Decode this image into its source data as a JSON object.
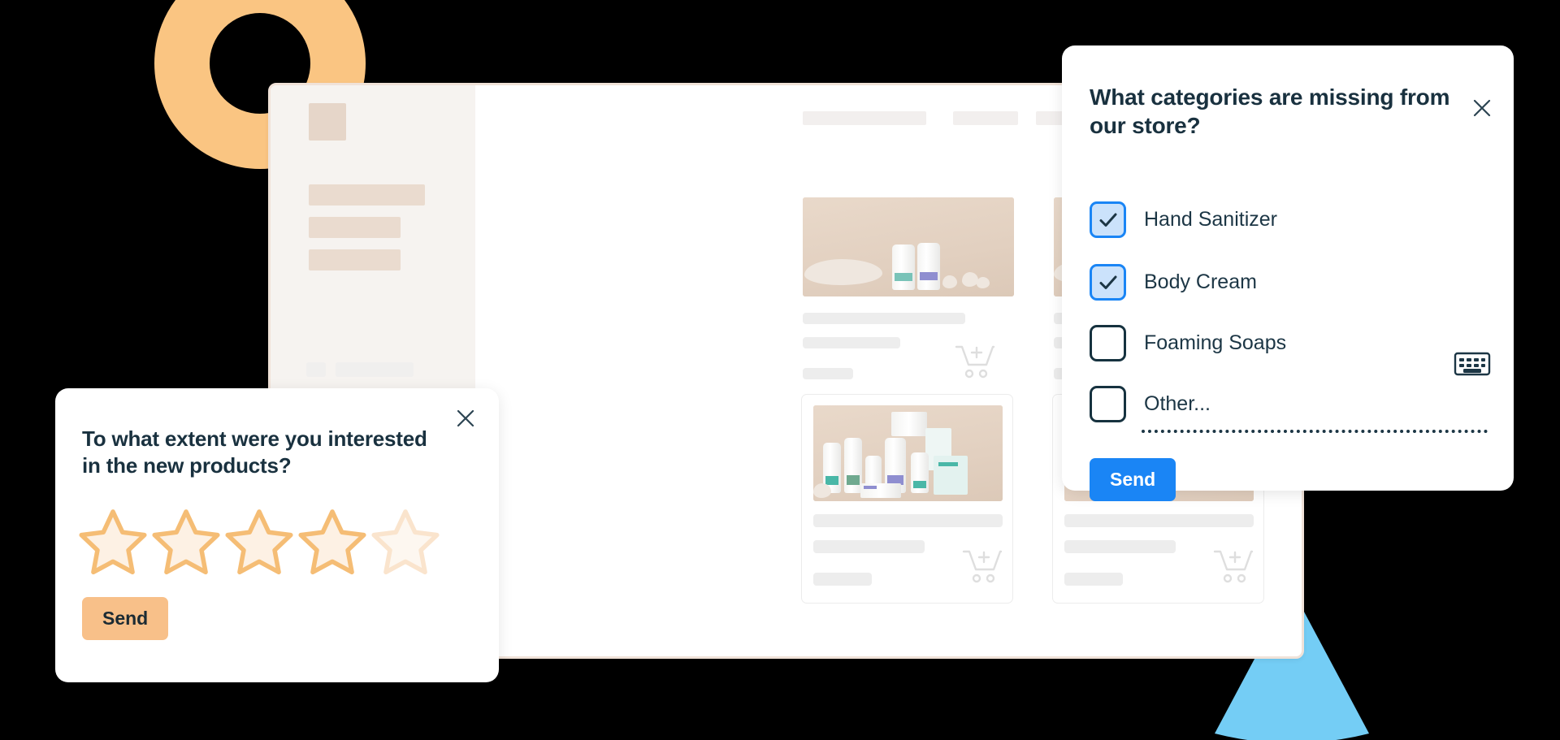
{
  "colors": {
    "accent_blue": "#1a85f5",
    "checkbox_fill": "#cbe2fb",
    "title_navy": "#19313f",
    "accent_orange": "#f8c089",
    "star_orange": "#f5bd75",
    "star_fill": "#fdf1e4",
    "donut_orange": "#fac582",
    "cone_blue": "#74cdf5",
    "store_sidebar": "#f6f3f0",
    "store_border": "#f0e2d8",
    "background": "#000000"
  },
  "decorations": {
    "donut": "orange-ring-shape",
    "cone": "blue-cone-shape"
  },
  "store": {
    "sidebar": {
      "logo": "logo-placeholder",
      "nav_placeholders": [
        "nav-line-1",
        "nav-line-2",
        "nav-line-3"
      ],
      "footer_placeholders": [
        "footer-1",
        "footer-2",
        "footer-3",
        "footer-4"
      ]
    },
    "topnav_placeholders": [
      "tab-1",
      "tab-2",
      "tab-3",
      "tab-4"
    ],
    "products": [
      {
        "id": "product-1",
        "image": "white-bottles-on-stone",
        "cart_icon": "add-to-cart-icon"
      },
      {
        "id": "product-2",
        "image": "stacked-jars-on-stone",
        "cart_icon": "add-to-cart-icon"
      },
      {
        "id": "product-3",
        "image": "product-partial-right",
        "cart_icon": "add-to-cart-icon"
      },
      {
        "id": "product-4",
        "image": "skincare-collection-boxes",
        "cart_icon": "add-to-cart-icon"
      },
      {
        "id": "product-5",
        "image": "glass-jar-with-greens",
        "cart_icon": "add-to-cart-icon"
      }
    ]
  },
  "categories_survey": {
    "close_icon": "close-icon",
    "title": "What categories are missing from our store?",
    "options": [
      {
        "label": "Hand Sanitizer",
        "checked": true
      },
      {
        "label": "Body Cream",
        "checked": true
      },
      {
        "label": "Foaming Soaps",
        "checked": false
      },
      {
        "label": "Other...",
        "checked": false
      }
    ],
    "other_input_placeholder": "Other...",
    "keyboard_icon": "keyboard-icon",
    "send_label": "Send"
  },
  "rating_survey": {
    "close_icon": "close-icon",
    "title": "To what extent were you interested in the new products?",
    "stars_total": 5,
    "stars_selected": 4,
    "send_label": "Send"
  }
}
